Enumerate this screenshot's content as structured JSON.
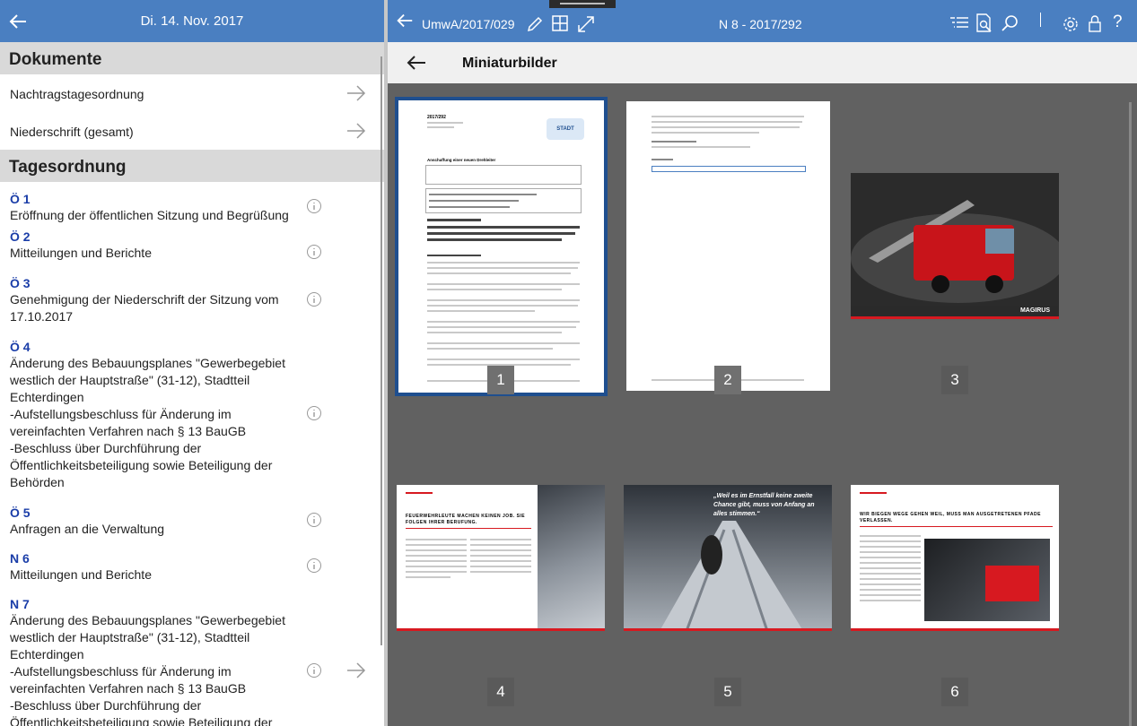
{
  "left": {
    "date": "Di. 14. Nov. 2017",
    "documents_heading": "Dokumente",
    "documents": [
      {
        "label": "Nachtragstagesordnung"
      },
      {
        "label": "Niederschrift (gesamt)"
      }
    ],
    "agenda_heading": "Tagesordnung",
    "agenda": [
      {
        "num": "Ö 1",
        "title": "Eröffnung der öffentlichen Sitzung und Begrüßung"
      },
      {
        "num": "Ö 2",
        "title": "Mitteilungen und Berichte"
      },
      {
        "num": "Ö 3",
        "title": "Genehmigung der Niederschrift der Sitzung vom\n17.10.2017"
      },
      {
        "num": "Ö 4",
        "title": "Änderung des Bebauungsplanes \"Gewerbegebiet\nwestlich der Hauptstraße\" (31-12), Stadtteil\nEchterdingen\n-Aufstellungsbeschluss für Änderung im\nvereinfachten Verfahren nach § 13 BauGB\n-Beschluss über Durchführung der\nÖffentlichkeitsbeteiligung sowie Beteiligung der\nBehörden"
      },
      {
        "num": "Ö 5",
        "title": "Anfragen an die Verwaltung"
      },
      {
        "num": "N 6",
        "title": "Mitteilungen und Berichte"
      },
      {
        "num": "N 7",
        "title": "Änderung des Bebauungsplanes \"Gewerbegebiet\nwestlich der Hauptstraße\" (31-12), Stadtteil\nEchterdingen\n-Aufstellungsbeschluss für Änderung im\nvereinfachten Verfahren nach § 13 BauGB\n-Beschluss über Durchführung der\nÖffentlichkeitsbeteiligung sowie Beteiligung der"
      }
    ]
  },
  "right": {
    "doc_id": "UmwA/2017/029",
    "page_id": "N 8 - 2017/292",
    "view_title": "Miniaturbilder",
    "pages": [
      "1",
      "2",
      "3",
      "4",
      "5",
      "6"
    ],
    "thumb1": {
      "doc_no": "2017/292",
      "heading": "Anschaffung einer neuen Drehleiter",
      "logo": "STADT"
    },
    "thumb3": {
      "brand": "MAGIRUS"
    },
    "thumb4": {
      "headline": "FEUERWEHRLEUTE MACHEN KEINEN JOB. SIE FOLGEN IHRER BERUFUNG."
    },
    "thumb5": {
      "quote": "„Weil es im Ernstfall keine zweite Chance gibt, muss von Anfang an alles stimmen.“"
    },
    "thumb6": {
      "headline": "WIR BIEGEN WEGE GEHEN WEIL, MUSS MAN AUSGETRETENEN PFADE VERLASSEN."
    }
  },
  "colors": {
    "accent": "#4a7fc1",
    "agenda_num": "#1a3da8",
    "viewer_bg": "#616161",
    "selection": "#1f4f8f"
  }
}
